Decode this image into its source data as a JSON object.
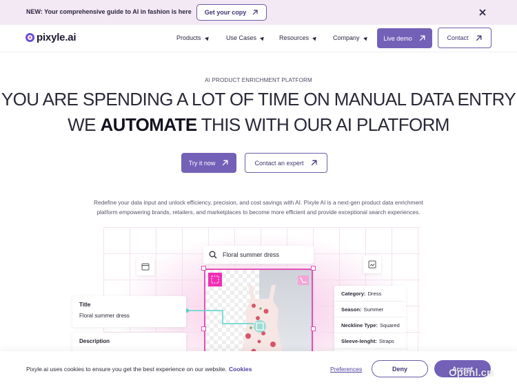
{
  "announcement": {
    "text": "NEW: Your comprehensive guide to AI in fashion is here",
    "cta_label": "Get your copy",
    "close_icon": "close-icon"
  },
  "nav": {
    "brand": "pixyle.ai",
    "items": [
      {
        "label": "Products"
      },
      {
        "label": "Use Cases"
      },
      {
        "label": "Resources"
      },
      {
        "label": "Company"
      }
    ],
    "live_demo_label": "Live demo",
    "contact_label": "Contact"
  },
  "hero": {
    "eyebrow": "AI PRODUCT ENRICHMENT PLATFORM",
    "headline_line1": "YOU ARE SPENDING A LOT OF TIME ON MANUAL DATA ENTRY",
    "headline_line2_pre": "WE ",
    "headline_line2_bold": "AUTOMATE",
    "headline_line2_post": " THIS WITH OUR AI PLATFORM",
    "try_label": "Try it now",
    "expert_label": "Contact an expert",
    "description": "Redefine your data input and unlock efficiency, precision, and cost savings with AI. Pixyle AI is a next-gen product data enrichment platform empowering brands, retailers, and marketplaces to become more efficient and provide exceptional search experiences."
  },
  "illustration": {
    "search_text": "Floral summer dress",
    "title_label": "Title",
    "title_value": "Floral summer dress",
    "description_label": "Description",
    "attributes": [
      {
        "name": "Category:",
        "value": "Dress"
      },
      {
        "name": "Season:",
        "value": "Summer"
      },
      {
        "name": "Neckline Type:",
        "value": "Squared"
      },
      {
        "name": "Sleeve-lenght:",
        "value": "Straps"
      }
    ]
  },
  "cookie": {
    "text": "Pixyle.ai uses cookies to ensure you get the best experience on our website.",
    "link": "Cookies",
    "preferences_label": "Preferences",
    "deny_label": "Deny",
    "accept_label": "Accept"
  },
  "watermark": "Openl.cn",
  "colors": {
    "primary": "#7361b8",
    "accent_pink": "#e24fb7",
    "announce_bg": "#f3e9f4"
  }
}
